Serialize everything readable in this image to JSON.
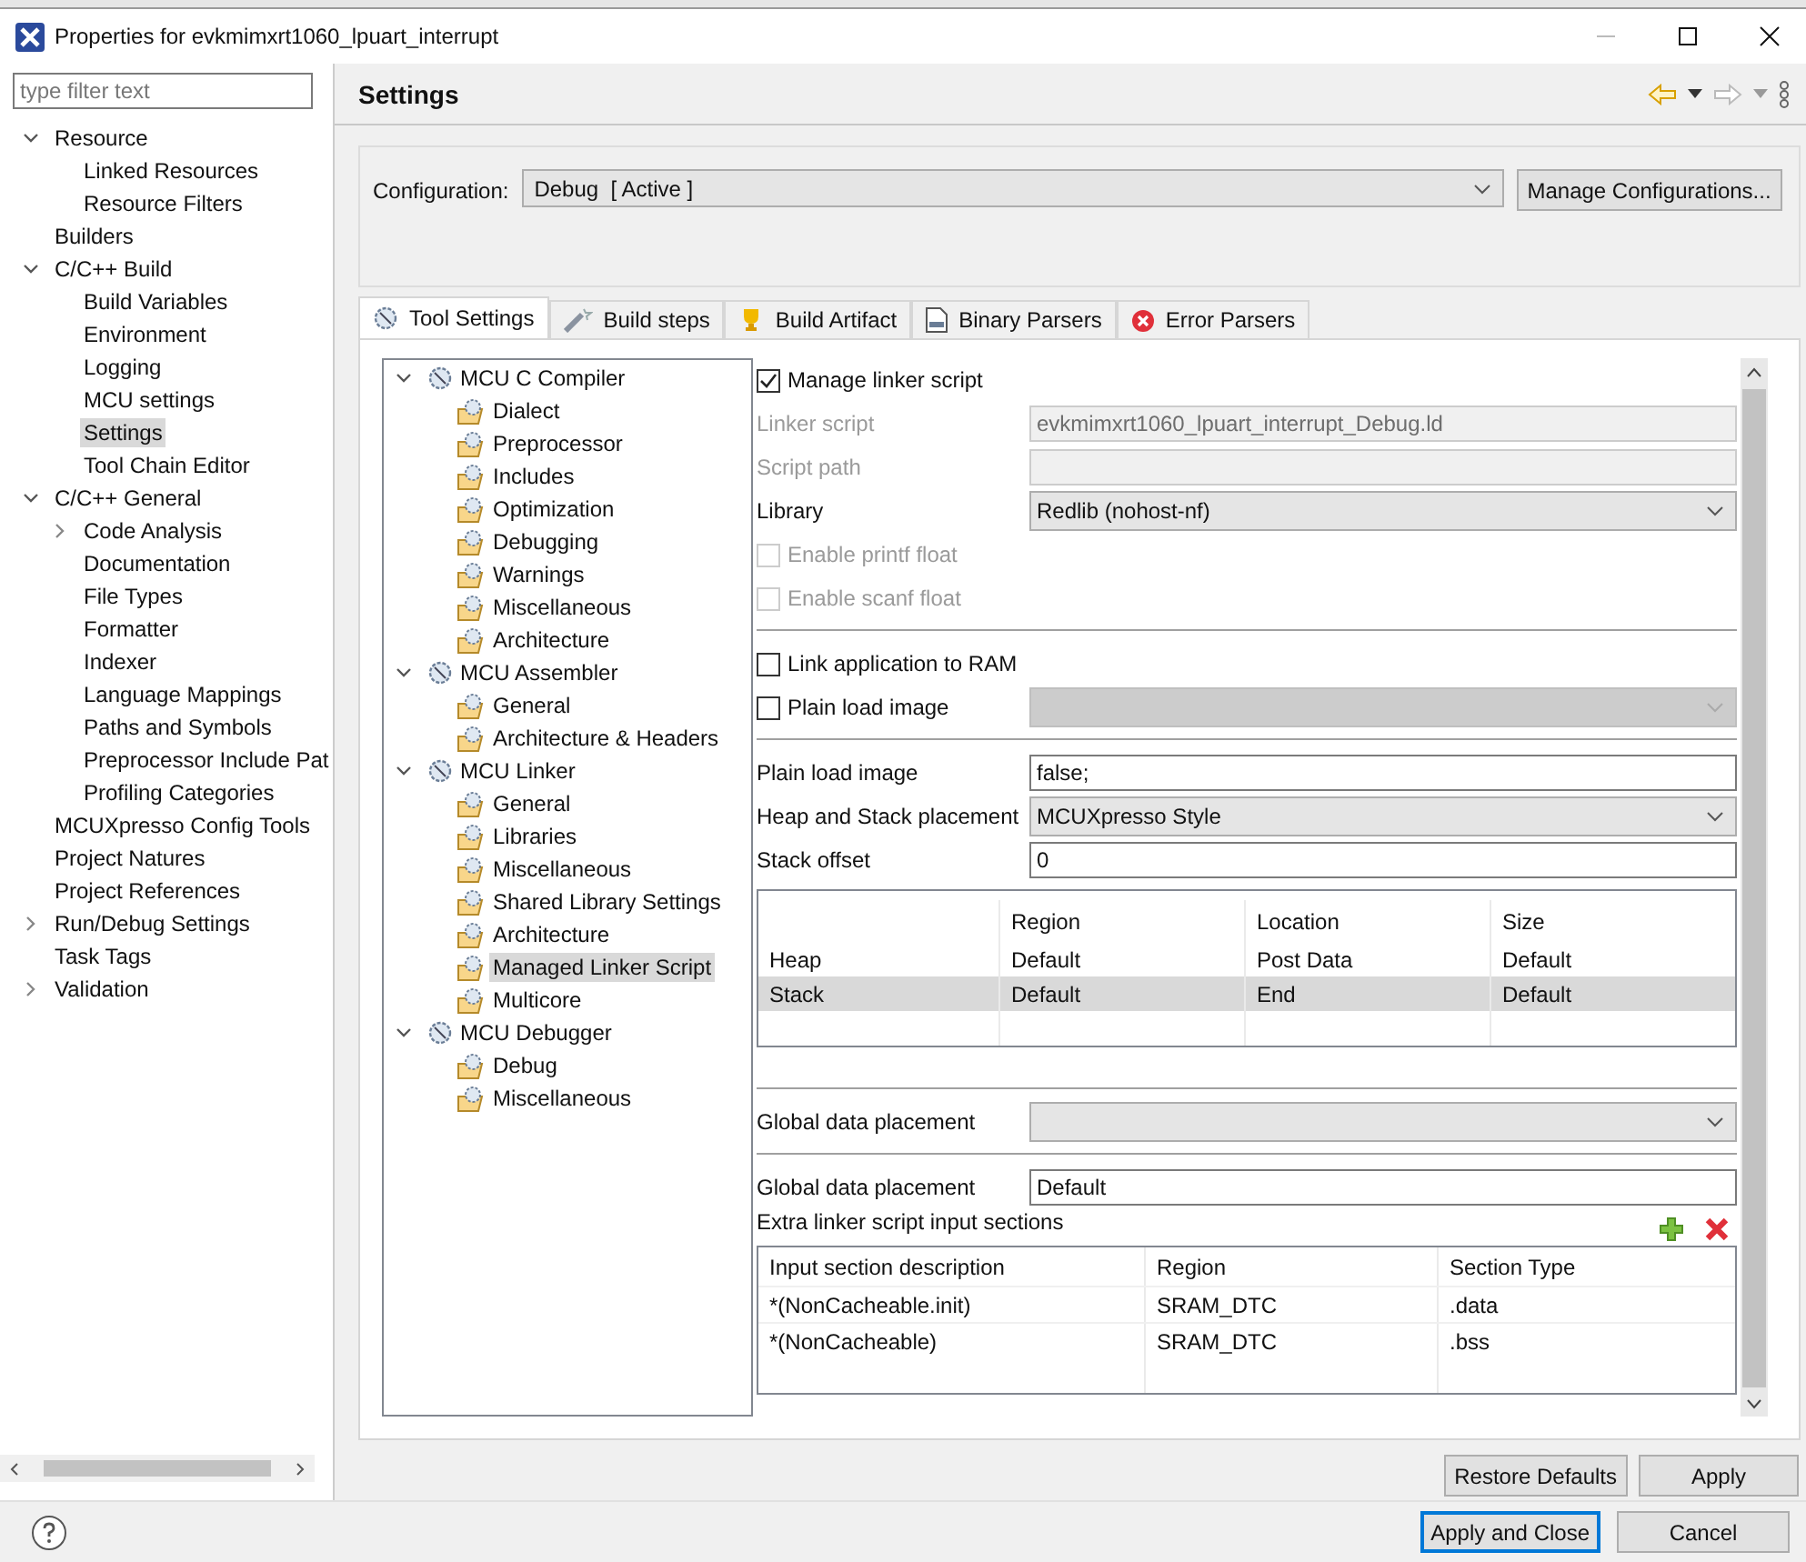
{
  "window": {
    "title": "Properties for evkmimxrt1060_lpuart_interrupt"
  },
  "filter": {
    "placeholder": "type filter text"
  },
  "sidebar": {
    "items": [
      {
        "label": "Resource",
        "expanded": true,
        "selected": false,
        "children": [
          {
            "label": "Linked Resources",
            "selected": false
          },
          {
            "label": "Resource Filters",
            "selected": false
          }
        ]
      },
      {
        "label": "Builders",
        "selected": false
      },
      {
        "label": "C/C++ Build",
        "expanded": true,
        "selected": false,
        "children": [
          {
            "label": "Build Variables",
            "selected": false
          },
          {
            "label": "Environment",
            "selected": false
          },
          {
            "label": "Logging",
            "selected": false
          },
          {
            "label": "MCU settings",
            "selected": false
          },
          {
            "label": "Settings",
            "selected": true
          },
          {
            "label": "Tool Chain Editor",
            "selected": false
          }
        ]
      },
      {
        "label": "C/C++ General",
        "expanded": true,
        "selected": false,
        "children": [
          {
            "label": "Code Analysis",
            "expanded": false,
            "selected": false
          },
          {
            "label": "Documentation",
            "selected": false
          },
          {
            "label": "File Types",
            "selected": false
          },
          {
            "label": "Formatter",
            "selected": false
          },
          {
            "label": "Indexer",
            "selected": false
          },
          {
            "label": "Language Mappings",
            "selected": false
          },
          {
            "label": "Paths and Symbols",
            "selected": false
          },
          {
            "label": "Preprocessor Include Pat",
            "selected": false
          },
          {
            "label": "Profiling Categories",
            "selected": false
          }
        ]
      },
      {
        "label": "MCUXpresso Config Tools",
        "selected": false
      },
      {
        "label": "Project Natures",
        "selected": false
      },
      {
        "label": "Project References",
        "selected": false
      },
      {
        "label": "Run/Debug Settings",
        "expanded": false,
        "selected": false
      },
      {
        "label": "Task Tags",
        "selected": false
      },
      {
        "label": "Validation",
        "expanded": false,
        "selected": false
      }
    ]
  },
  "page": {
    "title": "Settings"
  },
  "configuration": {
    "label": "Configuration:",
    "value": "Debug  [ Active ]",
    "button": "Manage Configurations..."
  },
  "tabs": [
    {
      "label": "Tool Settings",
      "selected": true
    },
    {
      "label": "Build steps",
      "selected": false
    },
    {
      "label": "Build Artifact",
      "selected": false
    },
    {
      "label": "Binary Parsers",
      "selected": false
    },
    {
      "label": "Error Parsers",
      "selected": false
    }
  ],
  "tool_tree": [
    {
      "label": "MCU C Compiler",
      "expanded": true,
      "selected": false,
      "children": [
        {
          "label": "Dialect",
          "selected": false
        },
        {
          "label": "Preprocessor",
          "selected": false
        },
        {
          "label": "Includes",
          "selected": false
        },
        {
          "label": "Optimization",
          "selected": false
        },
        {
          "label": "Debugging",
          "selected": false
        },
        {
          "label": "Warnings",
          "selected": false
        },
        {
          "label": "Miscellaneous",
          "selected": false
        },
        {
          "label": "Architecture",
          "selected": false
        }
      ]
    },
    {
      "label": "MCU Assembler",
      "expanded": true,
      "selected": false,
      "children": [
        {
          "label": "General",
          "selected": false
        },
        {
          "label": "Architecture & Headers",
          "selected": false
        }
      ]
    },
    {
      "label": "MCU Linker",
      "expanded": true,
      "selected": false,
      "children": [
        {
          "label": "General",
          "selected": false
        },
        {
          "label": "Libraries",
          "selected": false
        },
        {
          "label": "Miscellaneous",
          "selected": false
        },
        {
          "label": "Shared Library Settings",
          "selected": false
        },
        {
          "label": "Architecture",
          "selected": false
        },
        {
          "label": "Managed Linker Script",
          "selected": true
        },
        {
          "label": "Multicore",
          "selected": false
        }
      ]
    },
    {
      "label": "MCU Debugger",
      "expanded": true,
      "selected": false,
      "children": [
        {
          "label": "Debug",
          "selected": false
        },
        {
          "label": "Miscellaneous",
          "selected": false
        }
      ]
    }
  ],
  "sections": [
    [
      {
        "kind": "checkbox",
        "label": "Manage linker script",
        "checked": true,
        "disabled": false
      },
      {
        "kind": "field",
        "label": "Linker script",
        "value": "evkmimxrt1060_lpuart_interrupt_Debug.ld",
        "disabled": true
      },
      {
        "kind": "field",
        "label": "Script path",
        "disabled": true
      },
      {
        "kind": "select",
        "label": "Library",
        "value": "Redlib (nohost-nf)",
        "disabled": false
      },
      {
        "kind": "checkbox",
        "label": "Enable printf float",
        "checked": false,
        "disabled": true
      },
      {
        "kind": "checkbox",
        "label": "Enable scanf float",
        "checked": false,
        "disabled": true
      }
    ],
    [
      {
        "kind": "checkbox",
        "label": "Link application to RAM",
        "checked": false,
        "disabled": false
      },
      {
        "kind": "check-select",
        "label": "Plain load image",
        "checked": false,
        "disabled": true
      }
    ],
    [
      {
        "kind": "field",
        "label": "Plain load image",
        "value": "false;",
        "disabled": false
      },
      {
        "kind": "select",
        "label": "Heap and Stack placement",
        "value": "MCUXpresso Style",
        "disabled": false
      },
      {
        "kind": "field",
        "label": "Stack offset",
        "value": "0",
        "disabled": false
      },
      {
        "kind": "table",
        "columns": [
          "Region",
          "Location",
          "Size"
        ],
        "rows": [
          {
            "name": "Heap",
            "cells": [
              "Default",
              "Post Data",
              "Default"
            ],
            "selected": false
          },
          {
            "name": "Stack",
            "cells": [
              "Default",
              "End",
              "Default"
            ],
            "selected": true
          }
        ]
      }
    ],
    [
      {
        "kind": "select",
        "label": "Global data placement",
        "disabled": false
      }
    ],
    [
      {
        "kind": "field",
        "label": "Global data placement",
        "value": "Default",
        "disabled": false
      },
      {
        "kind": "heading",
        "label": "Extra linker script input sections"
      },
      {
        "kind": "list-table",
        "columns": [
          "Input section description",
          "Region",
          "Section Type"
        ],
        "rows": [
          {
            "cells": [
              "*(NonCacheable.init)",
              "SRAM_DTC",
              ".data"
            ],
            "selected": false
          },
          {
            "cells": [
              "*(NonCacheable)",
              "SRAM_DTC",
              ".bss"
            ],
            "selected": false
          }
        ]
      }
    ]
  ],
  "page_buttons": [
    "Restore Defaults",
    "Apply"
  ],
  "dialog_buttons": [
    {
      "label": "Apply and Close",
      "default": true
    },
    {
      "label": "Cancel",
      "default": false
    }
  ]
}
